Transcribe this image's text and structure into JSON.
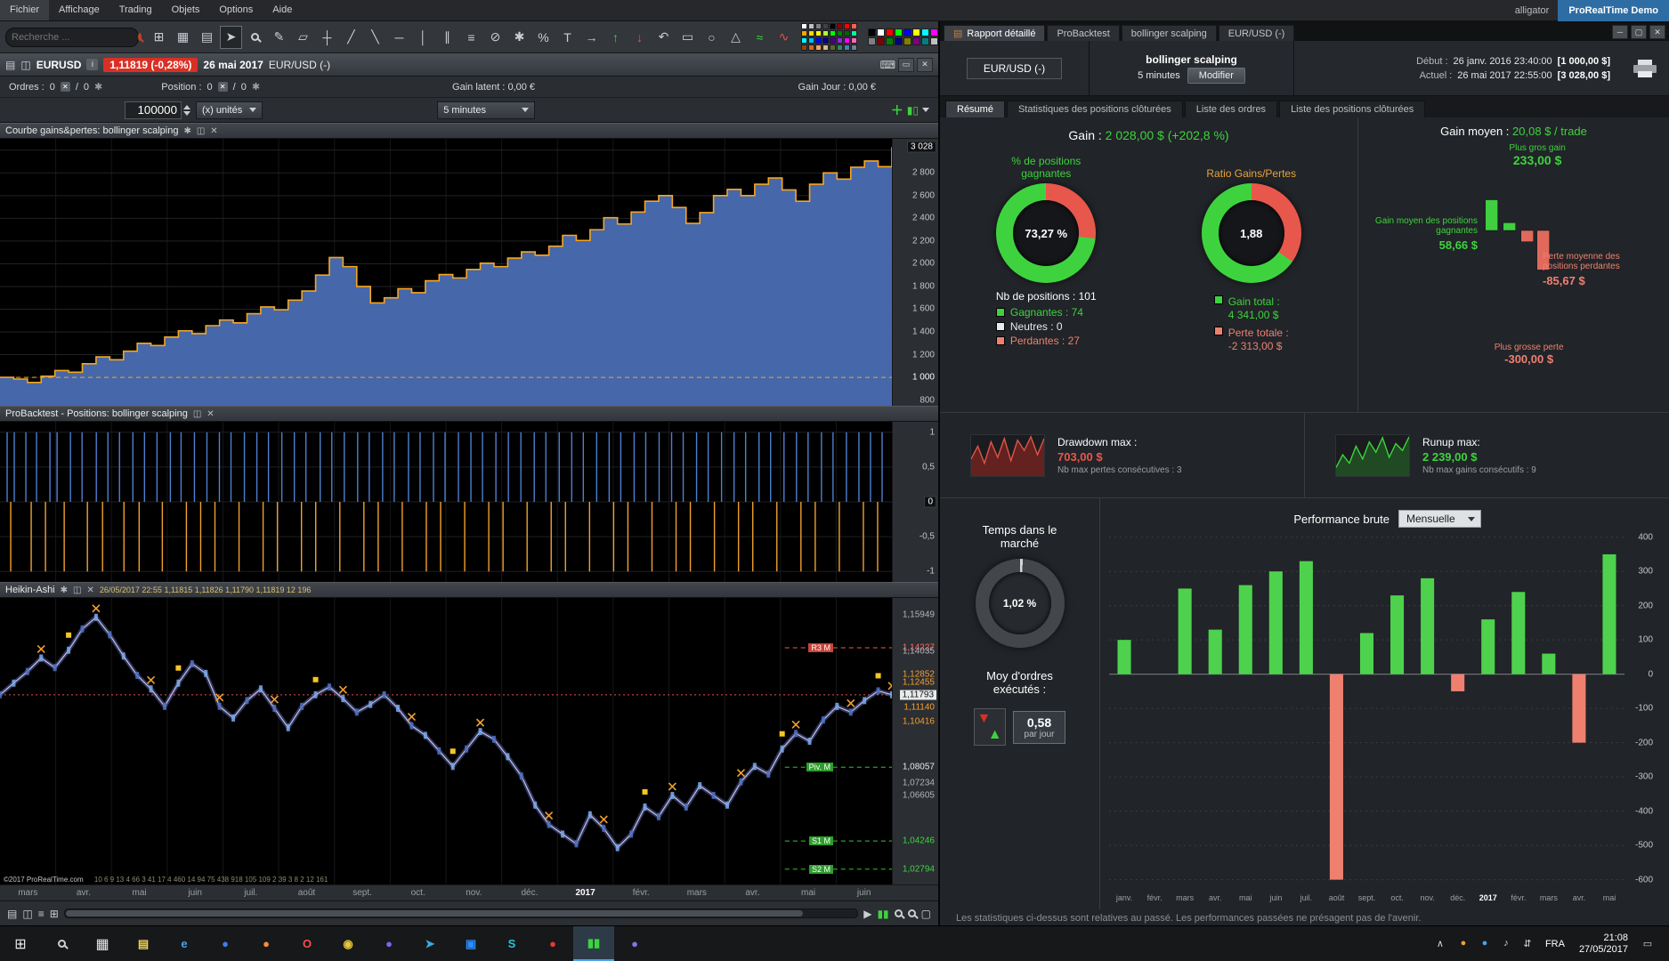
{
  "menubar": {
    "items": [
      "Fichier",
      "Affichage",
      "Trading",
      "Objets",
      "Options",
      "Aide"
    ],
    "user": "alligator",
    "brand": "ProRealTime Demo"
  },
  "toolbar": {
    "search_placeholder": "Recherche ...",
    "icons": [
      {
        "n": "screens-icon",
        "g": "⊞"
      },
      {
        "n": "layout-icon",
        "g": "▦"
      },
      {
        "n": "list-icon",
        "g": "▤"
      },
      {
        "n": "pointer-icon",
        "g": "➤",
        "active": true
      },
      {
        "n": "zoom-icon",
        "g": "MAG"
      },
      {
        "n": "brush-icon",
        "g": "✎"
      },
      {
        "n": "eraser-icon",
        "g": "▱"
      },
      {
        "n": "crosshair-icon",
        "g": "┼"
      },
      {
        "n": "trendline-icon",
        "g": "╱"
      },
      {
        "n": "segment-icon",
        "g": "╲"
      },
      {
        "n": "hline-icon",
        "g": "─"
      },
      {
        "n": "vline-icon",
        "g": "│"
      },
      {
        "n": "channel-icon",
        "g": "∥"
      },
      {
        "n": "fib-icon",
        "g": "≡"
      },
      {
        "n": "trash-icon",
        "g": "⊘"
      },
      {
        "n": "settings-icon",
        "g": "✱"
      },
      {
        "n": "percent-icon",
        "g": "%"
      },
      {
        "n": "text-icon",
        "g": "T"
      },
      {
        "n": "arrow-icon",
        "g": "→"
      },
      {
        "n": "buy-arrow-icon",
        "g": "↑",
        "c": "#3ed33e"
      },
      {
        "n": "sell-arrow-icon",
        "g": "↓",
        "c": "#e05448"
      },
      {
        "n": "undo-icon",
        "g": "↶"
      },
      {
        "n": "rect-icon",
        "g": "▭"
      },
      {
        "n": "ellipse-icon",
        "g": "○"
      },
      {
        "n": "triangle-icon",
        "g": "△"
      },
      {
        "n": "zigzag-icon",
        "g": "≈",
        "c": "#3ed33e"
      },
      {
        "n": "indicator-icon",
        "g": "∿",
        "c": "#e05448"
      }
    ],
    "palette1": [
      "#ffffff",
      "#c0c0c0",
      "#808080",
      "#404040",
      "#000000",
      "#8b0000",
      "#ff0000",
      "#ff6347",
      "#ffa500",
      "#ffd700",
      "#ffff00",
      "#adff2f",
      "#00ff00",
      "#008000",
      "#006400",
      "#00fa9a",
      "#00ffff",
      "#00bfff",
      "#0000ff",
      "#00008b",
      "#4b0082",
      "#8a2be2",
      "#ff00ff",
      "#ff69b4",
      "#8b4513",
      "#d2691e",
      "#f4a460",
      "#deb887",
      "#556b2f",
      "#2e8b57",
      "#4682b4",
      "#708090"
    ],
    "palette2": [
      "#000000",
      "#ffffff",
      "#ff0000",
      "#00ff00",
      "#0000ff",
      "#ffff00",
      "#00ffff",
      "#ff00ff",
      "#808080",
      "#800000",
      "#008000",
      "#000080",
      "#808000",
      "#800080",
      "#008080",
      "#c0c0c0"
    ]
  },
  "chart_window": {
    "titlebar": {
      "symbol": "EURUSD",
      "info": "i",
      "price_badge": "1,11819 (-0,28%)",
      "date": "26 mai 2017",
      "instrument": "EUR/USD (-)",
      "controls": [
        "▭",
        "✕"
      ],
      "kbd": "⌨"
    },
    "orders_row": {
      "orders_label": "Ordres :",
      "o1": "0",
      "sep": "/",
      "o2": "0",
      "position_label": "Position :",
      "p1": "0",
      "p2": "0",
      "gl_label": "Gain latent :",
      "gl": "0,00 €",
      "gj_label": "Gain Jour :",
      "gj": "0,00 €"
    },
    "qty_row": {
      "quantity": "100000",
      "units": "(x) unités",
      "timeframe": "5 minutes"
    },
    "panels": {
      "equity_title": "Courbe gains&pertes: bollinger scalping",
      "positions_title": "ProBacktest - Positions: bollinger scalping",
      "price_title": "Heikin-Ashi",
      "price_readout": "26/05/2017 22:55  1,11815  1,11826  1,11790  1,11819  12 196"
    },
    "strip": {
      "copyright": "©2017 ProRealTime.com",
      "numbers": "10 6 9 13 4 66 3 41 17 4 460 14 94 75 438 918 105 109 2 39 3 8 2 12 161"
    },
    "x_labels": [
      "mars",
      "avr.",
      "mai",
      "juin",
      "juil.",
      "août",
      "sept.",
      "oct.",
      "nov.",
      "déc.",
      "2017",
      "févr.",
      "mars",
      "avr.",
      "mai",
      "juin"
    ]
  },
  "report": {
    "window_tabs": [
      "Rapport détaillé",
      "ProBacktest",
      "bollinger scalping",
      "EUR/USD (-)"
    ],
    "window_controls": [
      "─",
      "▢",
      "✕"
    ],
    "header": {
      "instrument": "EUR/USD (-)",
      "strategy": "bollinger scalping",
      "timeframe": "5 minutes",
      "modify": "Modifier",
      "debut_label": "Début :",
      "debut_date": "26 janv. 2016 23:40:00",
      "debut_amount": "[1 000,00 $]",
      "actuel_label": "Actuel :",
      "actuel_date": "26 mai 2017 22:55:00",
      "actuel_amount": "[3 028,00 $]"
    },
    "tabs": [
      "Résumé",
      "Statistiques des positions clôturées",
      "Liste des ordres",
      "Liste des positions clôturées"
    ],
    "active_tab": 0,
    "gain_label": "Gain :",
    "gain_value": "2 028,00 $ (+202,8 %)",
    "gain_moyen_label": "Gain moyen :",
    "gain_moyen_value": "20,08 $ / trade",
    "colors": {
      "win": "#3ed33e",
      "lose": "#e8574b"
    },
    "winrate": {
      "label": "% de positions gagnantes",
      "value": "73,27 %",
      "pct": 73.27
    },
    "ratio": {
      "label": "Ratio Gains/Pertes",
      "value": "1,88",
      "pct": 65.3
    },
    "positions": {
      "total": "Nb de positions : 101",
      "legend": [
        {
          "label": "Gagnantes : 74",
          "color": "#3ed33e"
        },
        {
          "label": "Neutres : 0",
          "color": "#e8eaec"
        },
        {
          "label": "Perdantes : 27",
          "color": "#ef8070"
        }
      ]
    },
    "totals": [
      {
        "label": "Gain total :",
        "value": "4 341,00 $",
        "color": "#3ed33e"
      },
      {
        "label": "Perte totale :",
        "value": "-2 313,00 $",
        "color": "#ef8070"
      }
    ],
    "waterfall": {
      "plus_gros_gain_label": "Plus gros gain",
      "plus_gros_gain": "233,00 $",
      "gain_moyen_pos_label": "Gain moyen des positions gagnantes",
      "gain_moyen_pos": "58,66 $",
      "perte_moyenne_label": "Perte moyenne des positions perdantes",
      "perte_moyenne": "-85,67 $",
      "plus_grosse_perte_label": "Plus grosse perte",
      "plus_grosse_perte": "-300,00 $",
      "bars": [
        233,
        58.66,
        -85.67,
        -300
      ]
    },
    "drawdown": {
      "label": "Drawdown max :",
      "value": "703,00 $",
      "sub": "Nb max pertes consécutives : 3"
    },
    "runup": {
      "label": "Runup max:",
      "value": "2 239,00 $",
      "sub": "Nb max gains consécutifs : 9"
    },
    "market_time": {
      "label": "Temps dans le marché",
      "value": "1,02 %",
      "pct": 1.02
    },
    "orders_avg": {
      "label": "Moy d'ordres exécutés :",
      "value": "0,58",
      "unit": "par jour"
    },
    "performance": {
      "label": "Performance brute",
      "select": "Mensuelle"
    },
    "footer": "Les statistiques ci-dessus sont relatives au passé. Les performances passées ne présagent pas de l'avenir."
  },
  "taskbar": {
    "sys": [
      {
        "n": "start-button",
        "g": "⊞"
      },
      {
        "n": "search-button",
        "g": "MAG"
      },
      {
        "n": "task-view-button",
        "g": "▦"
      }
    ],
    "apps": [
      {
        "n": "file-explorer-icon",
        "g": "▤",
        "c": "#f6d04d"
      },
      {
        "n": "edge-icon",
        "g": "e",
        "c": "#4aa3e8"
      },
      {
        "n": "browser-icon",
        "g": "●",
        "c": "#3d7ce8"
      },
      {
        "n": "firefox-icon",
        "g": "●",
        "c": "#ff8a3c"
      },
      {
        "n": "opera-icon",
        "g": "O",
        "c": "#ff4b4b"
      },
      {
        "n": "chrome-icon",
        "g": "◉",
        "c": "#e8c83c"
      },
      {
        "n": "media-icon",
        "g": "●",
        "c": "#7b68ee"
      },
      {
        "n": "telegram-icon",
        "g": "➤",
        "c": "#35ade3"
      },
      {
        "n": "zoom-icon",
        "g": "▣",
        "c": "#2d8cff"
      },
      {
        "n": "skype-icon",
        "g": "S",
        "c": "#26c6da"
      },
      {
        "n": "store-icon",
        "g": "●",
        "c": "#e53935"
      },
      {
        "n": "prorealtime-icon",
        "g": "▮▮",
        "c": "#3ed33e",
        "active": true
      },
      {
        "n": "steam-icon",
        "g": "●",
        "c": "#8a6fe8"
      }
    ],
    "tray": {
      "expand": "∧",
      "icons": [
        {
          "n": "tray-app1-icon",
          "g": "●",
          "c": "#e8a33d"
        },
        {
          "n": "tray-app2-icon",
          "g": "●",
          "c": "#4aa3e8"
        },
        {
          "n": "tray-volume-icon",
          "g": "♪",
          "c": "#d6d8da"
        },
        {
          "n": "tray-network-icon",
          "g": "⇵",
          "c": "#d6d8da"
        }
      ],
      "lang": "FRA",
      "time": "21:08",
      "date": "27/05/2017",
      "notif": "▭"
    }
  },
  "chart_data": [
    {
      "id": "equity",
      "type": "area-step",
      "title": "Courbe gains&pertes: bollinger scalping",
      "ylim": [
        750,
        3100
      ],
      "baseline": 1000,
      "final": 3028,
      "line": "#f5a623",
      "fill": "#4a6db3",
      "grid": [
        800,
        1000,
        1200,
        1400,
        1600,
        1800,
        2000,
        2200,
        2400,
        2600,
        2800,
        3000
      ],
      "axis": [
        {
          "t": "3 028",
          "v": 3028,
          "s": "box"
        },
        {
          "t": "2 800",
          "v": 2800
        },
        {
          "t": "2 600",
          "v": 2600
        },
        {
          "t": "2 400",
          "v": 2400
        },
        {
          "t": "2 200",
          "v": 2200
        },
        {
          "t": "2 000",
          "v": 2000
        },
        {
          "t": "1 800",
          "v": 1800
        },
        {
          "t": "1 600",
          "v": 1600
        },
        {
          "t": "1 400",
          "v": 1400
        },
        {
          "t": "1 200",
          "v": 1200
        },
        {
          "t": "1 000",
          "v": 1000,
          "s": "bright"
        },
        {
          "t": "800",
          "v": 800
        }
      ],
      "values": [
        1000,
        985,
        955,
        1010,
        1060,
        1045,
        1120,
        1180,
        1155,
        1230,
        1300,
        1280,
        1355,
        1410,
        1385,
        1455,
        1505,
        1480,
        1560,
        1620,
        1595,
        1680,
        1760,
        1900,
        2055,
        1975,
        1800,
        1655,
        1700,
        1780,
        1745,
        1850,
        1905,
        1875,
        1950,
        2005,
        1975,
        2050,
        2105,
        2075,
        2155,
        2250,
        2205,
        2300,
        2405,
        2350,
        2455,
        2550,
        2600,
        2495,
        2355,
        2450,
        2600,
        2655,
        2600,
        2700,
        2755,
        2650,
        2550,
        2700,
        2800,
        2745,
        2850,
        2905,
        2855,
        3028
      ]
    },
    {
      "id": "positions",
      "type": "spikes",
      "title": "ProBacktest - Positions: bollinger scalping",
      "ylim": [
        -1.15,
        1.15
      ],
      "long_color": "#4f7fd0",
      "short_color": "#f0a030",
      "axis": [
        {
          "t": "1",
          "v": 1
        },
        {
          "t": "0,5",
          "v": 0.5
        },
        {
          "t": "0",
          "v": 0,
          "s": "box"
        },
        {
          "t": "-0,5",
          "v": -0.5
        },
        {
          "t": "-1",
          "v": -1
        }
      ],
      "long_x": [
        0.8,
        1.6,
        2.9,
        4.1,
        5.6,
        6.4,
        7.9,
        9.2,
        10.8,
        12.1,
        13.4,
        14.9,
        16.2,
        17.6,
        19.1,
        20.3,
        21.8,
        23.2,
        24.6,
        25.9,
        27.4,
        28.8,
        30.1,
        31.6,
        33.0,
        34.3,
        35.9,
        37.2,
        38.6,
        40.1,
        41.4,
        42.9,
        44.2,
        45.8,
        47.1,
        48.6,
        49.9,
        51.4,
        52.8,
        54.1,
        55.6,
        57.0,
        58.4,
        59.9,
        61.2,
        62.7,
        64.1,
        65.4,
        66.9,
        68.3,
        69.6,
        71.1,
        72.4,
        73.9,
        75.3,
        76.6,
        78.1,
        79.4,
        80.9,
        82.3,
        83.6,
        85.1,
        86.4,
        87.9,
        89.3,
        90.6,
        92.1,
        93.4,
        94.9,
        96.3,
        97.6,
        98.9
      ],
      "short_x": [
        1.2,
        3.5,
        5.1,
        7.2,
        9.8,
        11.5,
        13.9,
        15.6,
        18.2,
        20.9,
        22.5,
        24.1,
        26.8,
        29.5,
        31.1,
        33.8,
        35.4,
        38.1,
        40.8,
        42.4,
        45.1,
        47.8,
        49.4,
        52.1,
        54.8,
        56.4,
        59.1,
        61.8,
        63.4,
        66.1,
        68.8,
        70.4,
        73.1,
        75.8,
        77.4,
        80.1,
        82.8,
        84.4,
        87.1,
        89.8,
        91.4,
        94.1,
        96.8,
        98.4
      ]
    },
    {
      "id": "price",
      "type": "line",
      "title": "Heikin-Ashi",
      "ylim": [
        1.02,
        1.168
      ],
      "current": 1.11793,
      "levels": [
        {
          "label": "R3 M",
          "value": 1.14227,
          "color": "#c8443a"
        },
        {
          "label": "Piv. M",
          "value": 1.08057,
          "color": "#2d9e2d"
        },
        {
          "label": "S1 M",
          "value": 1.04246,
          "color": "#2d9e2d"
        },
        {
          "label": "S2 M",
          "value": 1.02794,
          "color": "#2d9e2d"
        }
      ],
      "axis": [
        {
          "t": "1,15949",
          "v": 1.15949,
          "c": "#b0b4b8"
        },
        {
          "t": "1,14227",
          "v": 1.14227,
          "c": "#ff6a5e"
        },
        {
          "t": "1,14035",
          "v": 1.14035,
          "c": "#b0b4b8"
        },
        {
          "t": "1,12852",
          "v": 1.12852,
          "c": "#f0a030"
        },
        {
          "t": "1,12455",
          "v": 1.12455,
          "c": "#f0a030"
        },
        {
          "t": "1,11793",
          "v": 1.11793,
          "c": "#111111",
          "bg": "#e8eaec"
        },
        {
          "t": "1,11140",
          "v": 1.1114,
          "c": "#f0a030"
        },
        {
          "t": "1,10416",
          "v": 1.10416,
          "c": "#f0a030"
        },
        {
          "t": "1,08057",
          "v": 1.08057,
          "c": "#e8eaec"
        },
        {
          "t": "1,07234",
          "v": 1.07234,
          "c": "#b0b4b8"
        },
        {
          "t": "1,06605",
          "v": 1.06605,
          "c": "#b0b4b8"
        },
        {
          "t": "1,04246",
          "v": 1.04246,
          "c": "#3ed33e"
        },
        {
          "t": "1,02794",
          "v": 1.02794,
          "c": "#3ed33e"
        }
      ],
      "values": [
        1.118,
        1.124,
        1.13,
        1.137,
        1.132,
        1.141,
        1.152,
        1.158,
        1.149,
        1.138,
        1.128,
        1.121,
        1.112,
        1.124,
        1.134,
        1.129,
        1.112,
        1.106,
        1.115,
        1.121,
        1.111,
        1.101,
        1.112,
        1.118,
        1.122,
        1.116,
        1.109,
        1.113,
        1.118,
        1.111,
        1.102,
        1.097,
        1.089,
        1.081,
        1.09,
        1.099,
        1.095,
        1.086,
        1.076,
        1.061,
        1.051,
        1.046,
        1.041,
        1.056,
        1.049,
        1.039,
        1.046,
        1.06,
        1.055,
        1.066,
        1.06,
        1.071,
        1.066,
        1.061,
        1.073,
        1.081,
        1.077,
        1.09,
        1.098,
        1.094,
        1.105,
        1.112,
        1.109,
        1.115,
        1.12,
        1.118
      ],
      "orange_idx": [
        3,
        7,
        11,
        16,
        20,
        25,
        30,
        35,
        40,
        44,
        49,
        54,
        58,
        62,
        65
      ],
      "flag_idx": [
        5,
        13,
        23,
        33,
        47,
        57,
        64
      ]
    },
    {
      "id": "perf",
      "type": "bar",
      "title": "Performance brute (Mensuelle)",
      "categories": [
        "janv.",
        "févr.",
        "mars",
        "avr.",
        "mai",
        "juin",
        "juil.",
        "août",
        "sept.",
        "oct.",
        "nov.",
        "déc.",
        "2017",
        "févr.",
        "mars",
        "avr.",
        "mai"
      ],
      "values": [
        100,
        0,
        250,
        130,
        260,
        300,
        330,
        -600,
        120,
        230,
        280,
        -50,
        160,
        240,
        60,
        -200,
        350
      ],
      "ylim": [
        -640,
        420
      ],
      "yticks": [
        400,
        300,
        200,
        100,
        0,
        -100,
        -200,
        -300,
        -400,
        -500,
        -600
      ],
      "pos_color": "#4ed24e",
      "neg_color": "#ef8070"
    },
    {
      "id": "dd_spark",
      "type": "area",
      "values": [
        20,
        35,
        15,
        40,
        22,
        44,
        18,
        42,
        30,
        46,
        25,
        44
      ],
      "stroke": "#e05448",
      "fill": "rgba(160,40,32,0.55)"
    },
    {
      "id": "runup_spark",
      "type": "area",
      "values": [
        10,
        25,
        15,
        35,
        20,
        40,
        28,
        45,
        22,
        38,
        30,
        46
      ],
      "stroke": "#3ed33e",
      "fill": "rgba(40,130,40,0.45)"
    }
  ]
}
